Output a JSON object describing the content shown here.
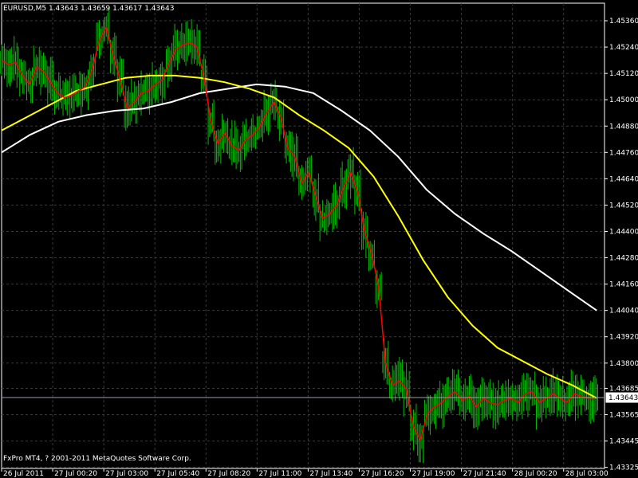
{
  "window": {
    "symbol_line": "EURUSD,M5  1.43643 1.43659 1.43617 1.43643",
    "copyright": "FxPro MT4, ? 2001-2011 MetaQuotes Software Corp."
  },
  "colors": {
    "background": "#000000",
    "grid": "#3a3a3a",
    "candles": "#00c000",
    "price_line": "#ff0000",
    "ma_fast": "#ffff00",
    "ma_slow": "#ffffff",
    "axis": "#ffffff"
  },
  "chart_data": {
    "type": "line",
    "symbol": "EURUSD",
    "timeframe": "M5",
    "ohlc_current": {
      "open": 1.43643,
      "high": 1.43659,
      "low": 1.43617,
      "close": 1.43643
    },
    "current_price_label": "1.43643",
    "ylim": [
      1.4332,
      1.4544
    ],
    "y_ticks": [
      "1.45360",
      "1.45240",
      "1.45120",
      "1.45000",
      "1.44880",
      "1.44760",
      "1.44640",
      "1.44520",
      "1.44400",
      "1.44280",
      "1.44160",
      "1.44040",
      "1.43920",
      "1.43800",
      "1.43685",
      "1.43565",
      "1.43445",
      "1.43325"
    ],
    "y_tick_values": [
      1.4536,
      1.4524,
      1.4512,
      1.45,
      1.4488,
      1.4476,
      1.4464,
      1.4452,
      1.444,
      1.4428,
      1.4416,
      1.4404,
      1.4392,
      1.438,
      1.43685,
      1.43565,
      1.43445,
      1.43325
    ],
    "x_ticks": [
      "26 Jul 2011",
      "27 Jul 00:20",
      "27 Jul 03:00",
      "27 Jul 05:40",
      "27 Jul 08:20",
      "27 Jul 11:00",
      "27 Jul 13:40",
      "27 Jul 16:20",
      "27 Jul 19:00",
      "27 Jul 21:40",
      "28 Jul 00:20",
      "28 Jul 03:00"
    ],
    "grid": true,
    "series": [
      {
        "role": "price",
        "values": [
          1.4518,
          1.4516,
          1.4517,
          1.4511,
          1.4507,
          1.4515,
          1.4513,
          1.4508,
          1.4503,
          1.4501,
          1.4502,
          1.4504,
          1.4506,
          1.4514,
          1.4527,
          1.4533,
          1.452,
          1.4509,
          1.4496,
          1.4499,
          1.4503,
          1.4504,
          1.4507,
          1.4509,
          1.4517,
          1.4523,
          1.4525,
          1.4526,
          1.4524,
          1.451,
          1.449,
          1.448,
          1.4485,
          1.4479,
          1.4477,
          1.4482,
          1.4484,
          1.4488,
          1.4494,
          1.4499,
          1.4492,
          1.4478,
          1.4474,
          1.4462,
          1.4467,
          1.4456,
          1.4446,
          1.4448,
          1.4452,
          1.446,
          1.4467,
          1.4458,
          1.444,
          1.443,
          1.4415,
          1.438,
          1.437,
          1.4372,
          1.4368,
          1.4351,
          1.4345,
          1.4357,
          1.436,
          1.4362,
          1.4365,
          1.4367,
          1.4363,
          1.4365,
          1.436,
          1.4364,
          1.4362,
          1.4361,
          1.4363,
          1.4364,
          1.4362,
          1.4366,
          1.4367,
          1.4362,
          1.4364,
          1.4366,
          1.4364,
          1.4362,
          1.4366,
          1.4365,
          1.4364,
          1.4364
        ]
      },
      {
        "role": "ma_fast",
        "values": [
          1.4486,
          1.4492,
          1.4498,
          1.4504,
          1.4507,
          1.451,
          1.4511,
          1.4511,
          1.451,
          1.4508,
          1.4505,
          1.4501,
          1.4493,
          1.4486,
          1.4478,
          1.4465,
          1.4447,
          1.4427,
          1.441,
          1.4397,
          1.4387,
          1.4381,
          1.4375,
          1.437,
          1.4364
        ]
      },
      {
        "role": "ma_slow",
        "values": [
          1.4476,
          1.4484,
          1.449,
          1.4493,
          1.4495,
          1.4496,
          1.4499,
          1.4503,
          1.4505,
          1.4507,
          1.4506,
          1.4503,
          1.4495,
          1.4486,
          1.4474,
          1.4459,
          1.4448,
          1.4439,
          1.4431,
          1.4422,
          1.4413,
          1.4404
        ]
      }
    ]
  }
}
